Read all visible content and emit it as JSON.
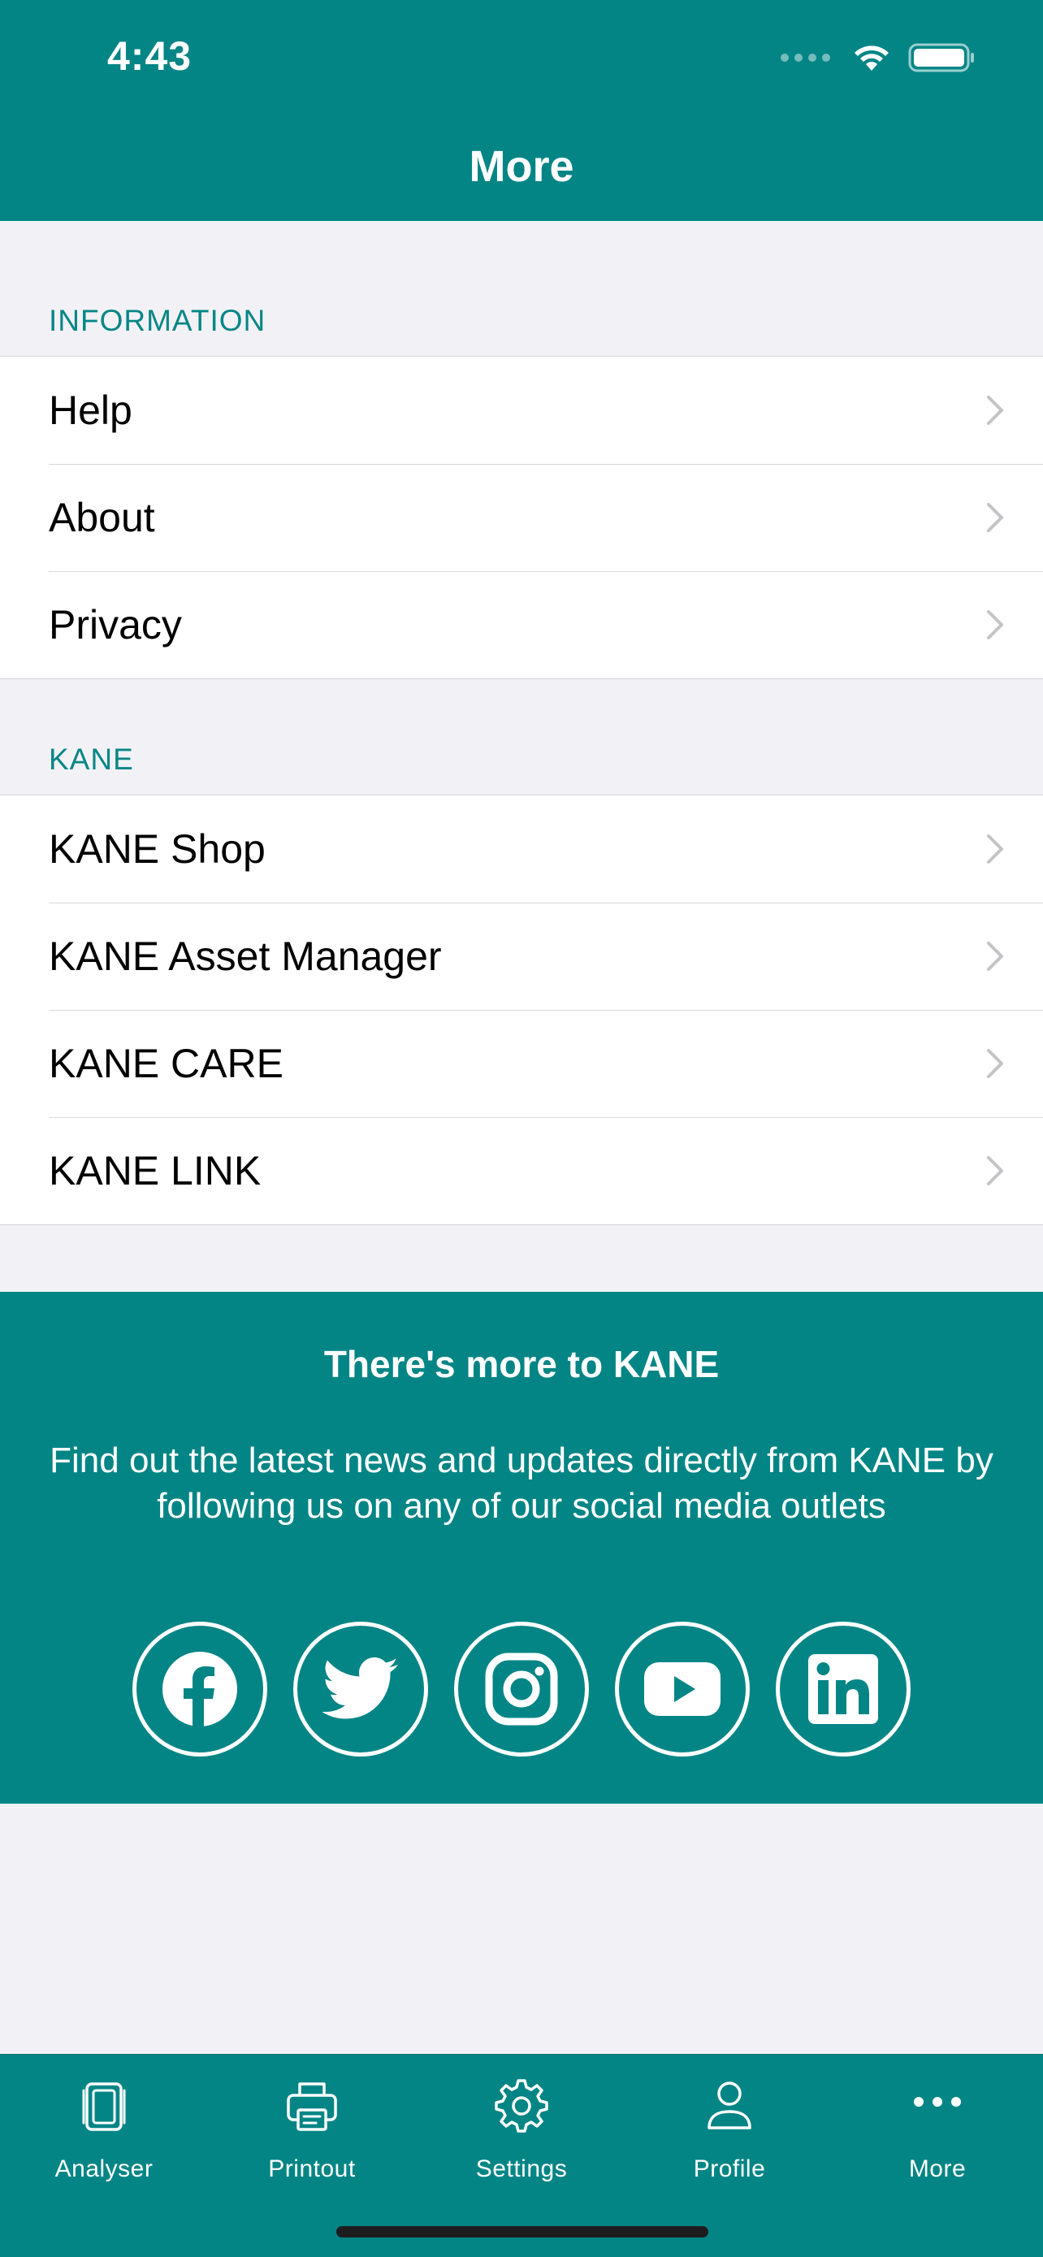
{
  "status": {
    "time": "4:43"
  },
  "nav": {
    "title": "More"
  },
  "information": {
    "header": "INFORMATION",
    "items": [
      {
        "label": "Help"
      },
      {
        "label": "About"
      },
      {
        "label": "Privacy"
      }
    ]
  },
  "kane": {
    "header": "KANE",
    "items": [
      {
        "label": "KANE Shop"
      },
      {
        "label": "KANE Asset Manager"
      },
      {
        "label": "KANE CARE"
      },
      {
        "label": "KANE LINK"
      }
    ]
  },
  "promo": {
    "title": "There's more to KANE",
    "text": "Find out the latest news and updates directly from KANE by following us on any of our social media outlets",
    "social_icons": [
      "facebook-icon",
      "twitter-icon",
      "instagram-icon",
      "youtube-icon",
      "linkedin-icon"
    ]
  },
  "tabbar": {
    "tabs": [
      {
        "label": "Analyser",
        "icon": "analyser-icon"
      },
      {
        "label": "Printout",
        "icon": "printer-icon"
      },
      {
        "label": "Settings",
        "icon": "gear-icon"
      },
      {
        "label": "Profile",
        "icon": "person-icon"
      },
      {
        "label": "More",
        "icon": "ellipsis-icon"
      }
    ],
    "active": "More"
  },
  "colors": {
    "brand_teal": "#048585",
    "section_header": "#078686",
    "background": "#f2f2f6"
  }
}
